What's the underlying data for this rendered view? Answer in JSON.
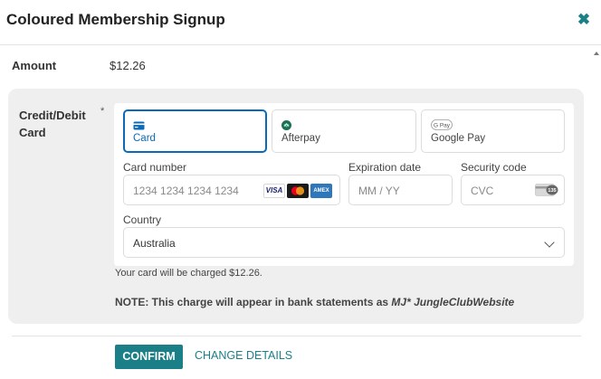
{
  "dialog": {
    "title": "Coloured Membership Signup",
    "close_icon": "✖"
  },
  "amount": {
    "label": "Amount",
    "value": "$12.26"
  },
  "payment": {
    "field_label": "Credit/Debit Card",
    "required_marker": "*",
    "methods": [
      {
        "label": "Card",
        "icon": "card-icon",
        "selected": true
      },
      {
        "label": "Afterpay",
        "icon": "afterpay-icon",
        "selected": false
      },
      {
        "label": "Google Pay",
        "icon": "google-pay-icon",
        "selected": false
      }
    ],
    "gpay_icon_text": "G Pay",
    "card_number": {
      "label": "Card number",
      "placeholder": "1234 1234 1234 1234",
      "brands": [
        "VISA",
        "Mastercard",
        "AMEX"
      ]
    },
    "expiration": {
      "label": "Expiration date",
      "placeholder": "MM / YY"
    },
    "security": {
      "label": "Security code",
      "placeholder": "CVC",
      "badge": "135"
    },
    "country": {
      "label": "Country",
      "value": "Australia"
    }
  },
  "charge_notice": "Your card will be charged $12.26.",
  "note": {
    "text": "NOTE: This charge will appear in bank statements as ",
    "merchant": "MJ* JungleClubWebsite"
  },
  "actions": {
    "confirm_label": "CONFIRM",
    "change_label": "CHANGE DETAILS"
  },
  "colors": {
    "accent": "#1b7f87",
    "selected_border": "#0b6ab8",
    "panel_bg": "#efefef"
  }
}
